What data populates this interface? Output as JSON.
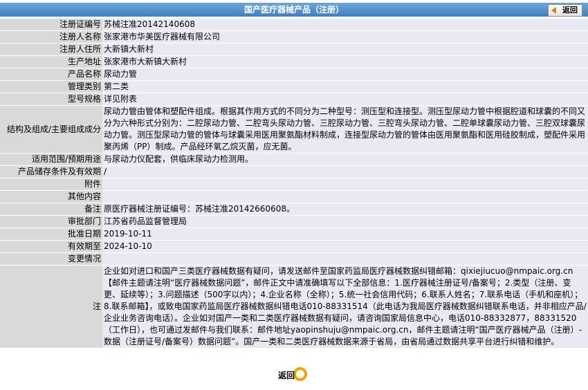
{
  "header": {
    "title": "国产医疗器械产品（注册）",
    "back_label": "返回"
  },
  "rows": [
    {
      "label": "注册证编号",
      "value": "苏械注准20142140608"
    },
    {
      "label": "注册人名称",
      "value": "张家港市华美医疗器械有限公司"
    },
    {
      "label": "注册人住所",
      "value": "大新镇大新村"
    },
    {
      "label": "生产地址",
      "value": "张家港市大新镇大新村"
    },
    {
      "label": "产品名称",
      "value": "尿动力管"
    },
    {
      "label": "管理类别",
      "value": "第二类"
    },
    {
      "label": "型号规格",
      "value": "详见附表"
    },
    {
      "label": "结构及组成/主要组成成分",
      "value": "尿动力管由管体和塑配件组成。根据其作用方式的不同分为二种型号：测压型和连接型。测压型尿动力管中根据腔道和球囊的不同又分为六种形式分别为：二腔尿动力管、二腔弯头尿动力管、三腔尿动力管、三腔弯头尿动力管、二腔单球囊尿动力管、三腔双球囊尿动力管。测压型尿动力管的管体与球囊采用医用聚氨酯材料制成，连接型尿动力管的管体由医用聚氨酯和医用硅胶制成，塑配件采用聚丙烯（PP）制成。产品经环氧乙烷灭菌，应无菌。"
    },
    {
      "label": "适用范围/预期用途",
      "value": "与尿动力仪配套，供临床尿动力检测用。"
    },
    {
      "label": "产品储存条件及有效期",
      "value": "/"
    },
    {
      "label": "附件",
      "value": ""
    },
    {
      "label": "其他内容",
      "value": ""
    },
    {
      "label": "备注",
      "value": "原医疗器械注册证编号：苏械注准20142660608。"
    },
    {
      "label": "审批部门",
      "value": "江苏省药品监督管理局"
    },
    {
      "label": "批准日期",
      "value": "2019-10-11"
    },
    {
      "label": "有效期至",
      "value": "2024-10-10"
    },
    {
      "label": "变更情况",
      "value": ""
    }
  ],
  "note": {
    "label": "注",
    "text": "企业如对进口和国产三类医疗器械数据有疑问，请发送邮件至国家药监局医疗器械数据纠错邮箱：qixiejiucuo@nmpaic.org.cn【邮件主题请注明“医疗器械数据问题”，邮件正文中请准确填写以下全部信息：1.医疗器械注册证号/备案号；2.类型（注册、变更、延续等）；3.问题描述（500字以内）；4.企业名称（全称）；5.统一社会信用代码；6.联系人姓名；7.联系电话（手机和座机）；8.联系邮箱】，或致电国家药监局医疗器械数据纠错电话010-88331514（此电话为我局医疗器械数据纠错联系电话，并非相应产品/企业业务咨询电话）。企业如对国产一类和二类医疗器械数据有疑问，请咨询国家局信息中心，电话010-88332877，88331520（工作日），也可通过发邮件与我们联系：邮件地址yaopinshuju@nmpaic.org.cn，邮件主题请注明“国产医疗器械产品（注册）-数据（注册证号/备案号）数据问题”。国产一类和二类医疗器械数据来源于省局，由省局通过数据共享平台进行纠错和维护。"
  },
  "footer": {
    "back_label": "返回"
  }
}
